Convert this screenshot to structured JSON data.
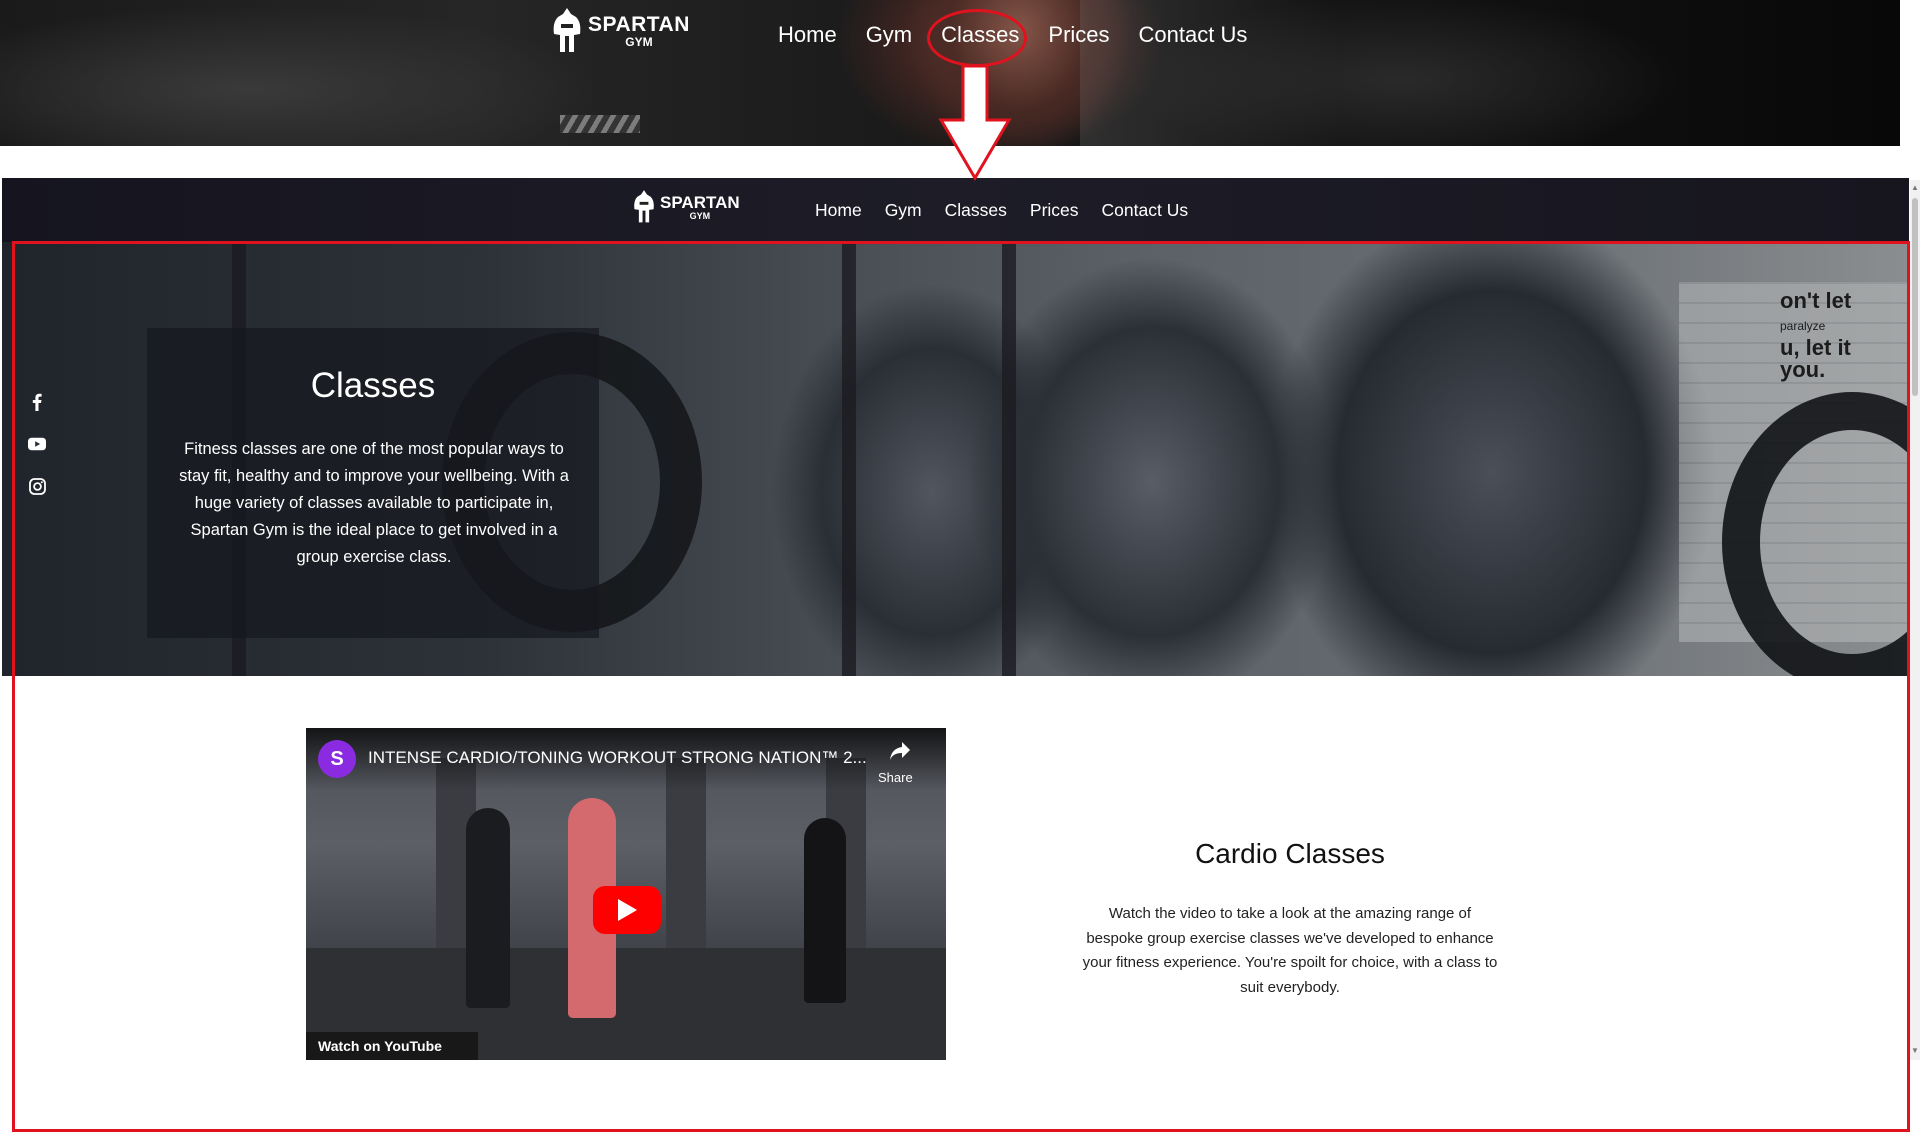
{
  "top_header": {
    "logo": {
      "brand": "SPARTAN",
      "sub": "GYM"
    },
    "nav": [
      "Home",
      "Gym",
      "Classes",
      "Prices",
      "Contact Us"
    ],
    "highlighted_item": "Classes"
  },
  "page": {
    "logo": {
      "brand": "SPARTAN",
      "sub": "GYM"
    },
    "nav": [
      "Home",
      "Gym",
      "Classes",
      "Prices",
      "Contact Us"
    ],
    "hero": {
      "title": "Classes",
      "body": "Fitness classes are one of the most popular ways to stay fit, healthy and to improve your wellbeing. With a huge variety of classes available to participate in, Spartan Gym is the ideal place to get involved in a group exercise class.",
      "wall_text_1": "on't let",
      "wall_text_2": "paralyze",
      "wall_text_3": "u, let it",
      "wall_text_4": "you."
    },
    "socials": [
      "facebook-icon",
      "youtube-icon",
      "instagram-icon"
    ],
    "video": {
      "channel_letter": "S",
      "title": "INTENSE CARDIO/TONING WORKOUT STRONG NATION™ 2...",
      "share_label": "Share",
      "watch_label": "Watch on YouTube"
    },
    "cardio": {
      "title": "Cardio Classes",
      "body": "Watch the video to take a look at the amazing range of bespoke group exercise classes we've developed to enhance your fitness experience. You're spoilt for choice, with a class to suit everybody."
    }
  },
  "annotation_color": "#e0121e"
}
